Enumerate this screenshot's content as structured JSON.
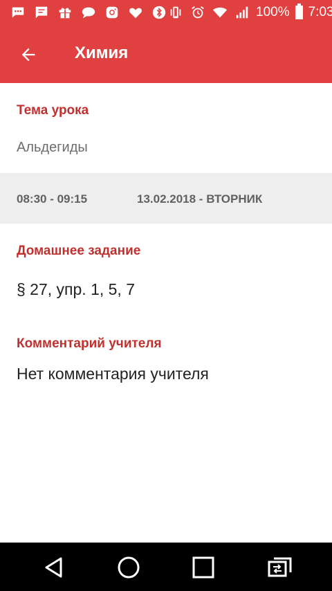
{
  "status_bar": {
    "battery_percent": "100%",
    "time": "7:03",
    "icons": [
      "messages-icon",
      "chat-icon",
      "gift-icon",
      "speech-bubble-icon",
      "instagram-icon",
      "heart-icon",
      "bluetooth-icon",
      "vibrate-icon",
      "alarm-icon",
      "wifi-icon",
      "signal-icon",
      "battery-icon"
    ]
  },
  "app_bar": {
    "title": "Химия",
    "back_icon": "arrow-left-icon"
  },
  "lesson": {
    "topic_label": "Тема урока",
    "topic_value": "Альдегиды",
    "time_range": "08:30 - 09:15",
    "date": "13.02.2018 - ВТОРНИК",
    "homework_label": "Домашнее задание",
    "homework_value": "§ 27, упр. 1, 5, 7",
    "comment_label": "Комментарий учителя",
    "comment_value": "Нет комментария учителя"
  },
  "nav_bar": {
    "icons": [
      "back-triangle-icon",
      "home-circle-icon",
      "recents-square-icon",
      "switch-app-icon"
    ]
  },
  "colors": {
    "accent": "#e04040",
    "label_red": "#c0302e",
    "band_gray": "#eeeeee"
  }
}
